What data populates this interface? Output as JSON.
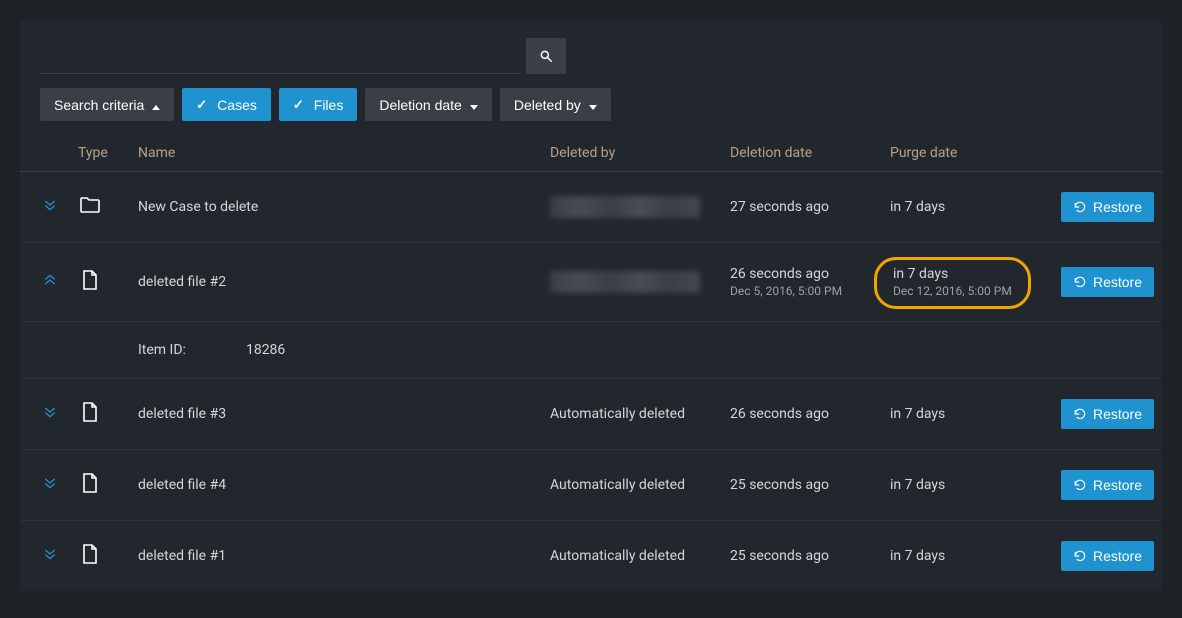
{
  "toolbar": {
    "search_placeholder": "",
    "search_criteria_label": "Search criteria",
    "cases_label": "Cases",
    "files_label": "Files",
    "deletion_date_label": "Deletion date",
    "deleted_by_label": "Deleted by"
  },
  "columns": {
    "type": "Type",
    "name": "Name",
    "deleted_by": "Deleted by",
    "deletion_date": "Deletion date",
    "purge_date": "Purge date"
  },
  "restore_label": "Restore",
  "detail": {
    "item_id_label": "Item ID:",
    "item_id_value": "18286"
  },
  "rows": [
    {
      "expand_dir": "down",
      "type": "folder",
      "name": "New Case to delete",
      "deleted_by_blur": true,
      "deleted_by_text": "",
      "deletion_date": "27 seconds ago",
      "deletion_date_sub": "",
      "purge_date": "in 7 days",
      "purge_date_sub": "",
      "highlight_purge": false,
      "has_detail": false
    },
    {
      "expand_dir": "up",
      "type": "file",
      "name": "deleted file #2",
      "deleted_by_blur": true,
      "deleted_by_text": "",
      "deletion_date": "26 seconds ago",
      "deletion_date_sub": "Dec 5, 2016, 5:00 PM",
      "purge_date": "in 7 days",
      "purge_date_sub": "Dec 12, 2016, 5:00 PM",
      "highlight_purge": true,
      "has_detail": true
    },
    {
      "expand_dir": "down",
      "type": "file",
      "name": "deleted file #3",
      "deleted_by_blur": false,
      "deleted_by_text": "Automatically deleted",
      "deletion_date": "26 seconds ago",
      "deletion_date_sub": "",
      "purge_date": "in 7 days",
      "purge_date_sub": "",
      "highlight_purge": false,
      "has_detail": false
    },
    {
      "expand_dir": "down",
      "type": "file",
      "name": "deleted file #4",
      "deleted_by_blur": false,
      "deleted_by_text": "Automatically deleted",
      "deletion_date": "25 seconds ago",
      "deletion_date_sub": "",
      "purge_date": "in 7 days",
      "purge_date_sub": "",
      "highlight_purge": false,
      "has_detail": false
    },
    {
      "expand_dir": "down",
      "type": "file",
      "name": "deleted file #1",
      "deleted_by_blur": false,
      "deleted_by_text": "Automatically deleted",
      "deletion_date": "25 seconds ago",
      "deletion_date_sub": "",
      "purge_date": "in 7 days",
      "purge_date_sub": "",
      "highlight_purge": false,
      "has_detail": false
    }
  ]
}
